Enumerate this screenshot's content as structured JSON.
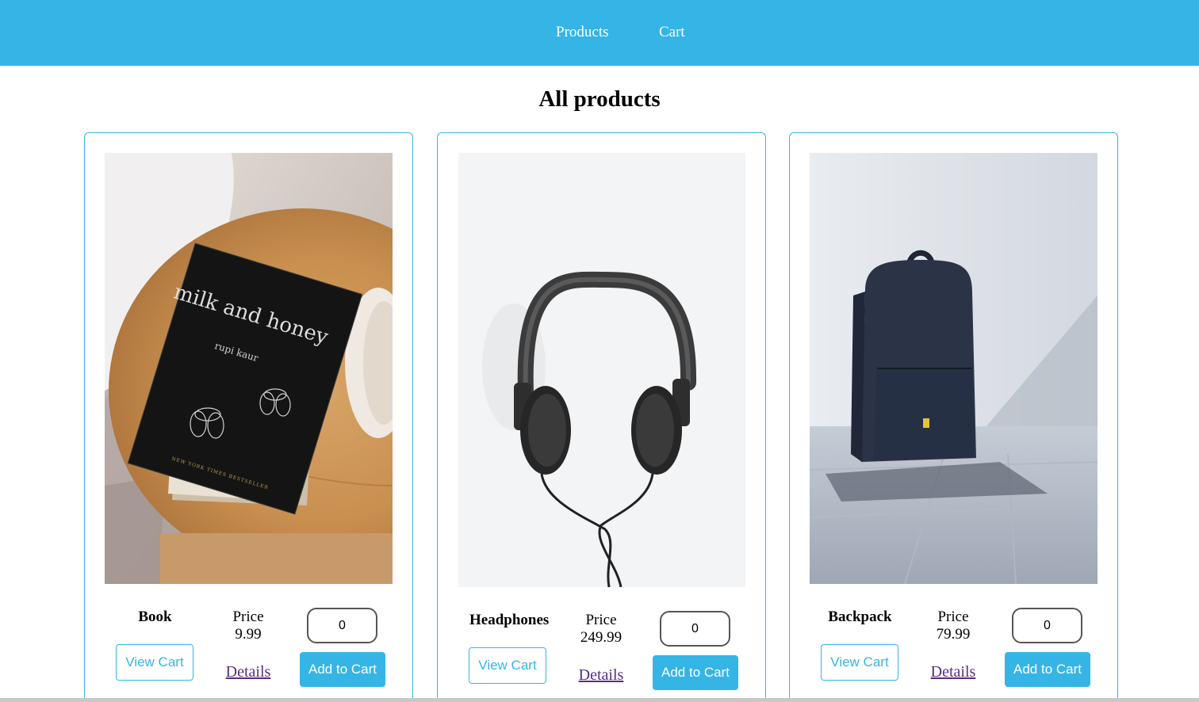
{
  "nav": {
    "products_label": "Products",
    "cart_label": "Cart"
  },
  "page": {
    "title": "All products"
  },
  "colors": {
    "accent": "#35b5e6",
    "link_visited": "#5a2c82"
  },
  "products": [
    {
      "name": "Book",
      "price_label": "Price",
      "price": "9.99",
      "qty": "0",
      "view_cart_label": "View Cart",
      "details_label": "Details",
      "add_label": "Add to Cart",
      "image_title": "milk and honey",
      "image_author": "rupi kaur",
      "image_badge": "NEW YORK TIMES BESTSELLER"
    },
    {
      "name": "Headphones",
      "price_label": "Price",
      "price": "249.99",
      "qty": "0",
      "view_cart_label": "View Cart",
      "details_label": "Details",
      "add_label": "Add to Cart"
    },
    {
      "name": "Backpack",
      "price_label": "Price",
      "price": "79.99",
      "qty": "0",
      "view_cart_label": "View Cart",
      "details_label": "Details",
      "add_label": "Add to Cart"
    }
  ]
}
